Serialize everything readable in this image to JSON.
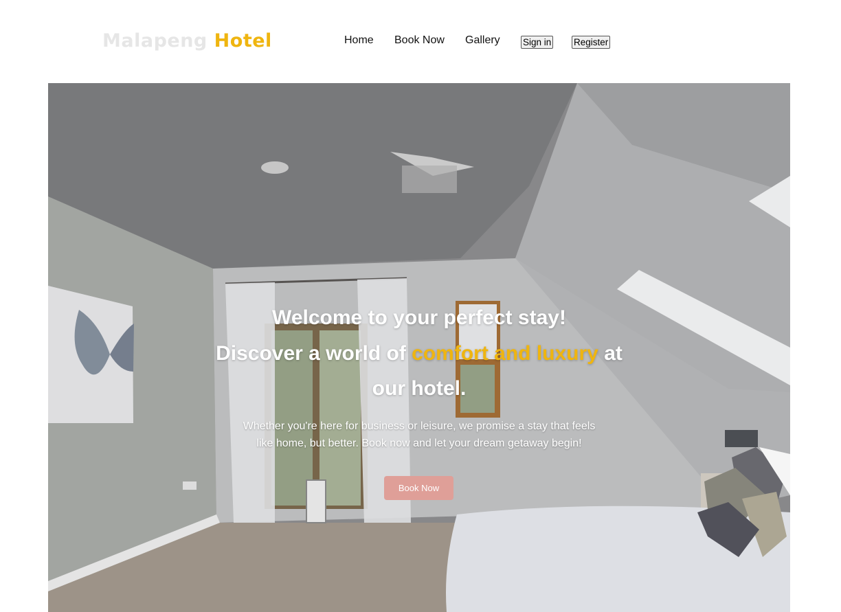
{
  "brand": {
    "name_part1": "Malapeng",
    "name_part2": "Hotel",
    "accent_color": "#efb510",
    "light_color": "#e6e6e6"
  },
  "nav": {
    "links": [
      "Home",
      "Book Now",
      "Gallery"
    ],
    "signin_label": "Sign in",
    "register_label": "Register"
  },
  "hero": {
    "headline_line1": "Welcome to your perfect stay!",
    "headline_pre": "Discover a world of ",
    "headline_accent": "comfort and luxury",
    "headline_post": " at our hotel.",
    "subtext": "Whether you're here for business or leisure, we promise a stay that feels like home, but better. Book now and let your dream getaway begin!",
    "cta_label": "Book Now",
    "cta_color": "#df9f98",
    "background_image": "bedroom-photo"
  }
}
